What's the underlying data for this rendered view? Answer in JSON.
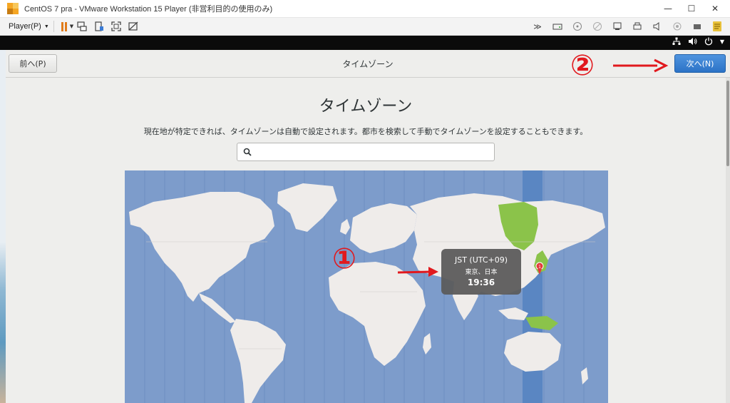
{
  "window": {
    "title": "CentOS 7 pra - VMware Workstation 15 Player (非営利目的の使用のみ)",
    "minimize_glyph": "—",
    "maximize_glyph": "☐",
    "close_glyph": "✕"
  },
  "toolbar": {
    "player_label": "Player(P)",
    "player_caret": "▼",
    "pause_caret": "▼"
  },
  "installer": {
    "header_title": "タイムゾーン",
    "back_label": "前へ(P)",
    "next_label": "次へ(N)",
    "page_title": "タイムゾーン",
    "subtitle": "現在地が特定できれば、タイムゾーンは自動で設定されます。都市を検索して手動でタイムゾーンを設定することもできます。",
    "search": {
      "value": "",
      "placeholder": ""
    }
  },
  "map": {
    "tooltip": {
      "zone": "JST (UTC+09)",
      "city": "東京、日本",
      "time": "19:36"
    },
    "selected_marker": "1"
  },
  "annotations": {
    "step1": "①",
    "step2": "②"
  },
  "colors": {
    "ocean": "#7d9ccb",
    "land": "#efecea",
    "selected_band": "#5a86c2",
    "selected_region": "#8bc34a",
    "next_button": "#3a80d3",
    "annotation": "#e1191e"
  }
}
